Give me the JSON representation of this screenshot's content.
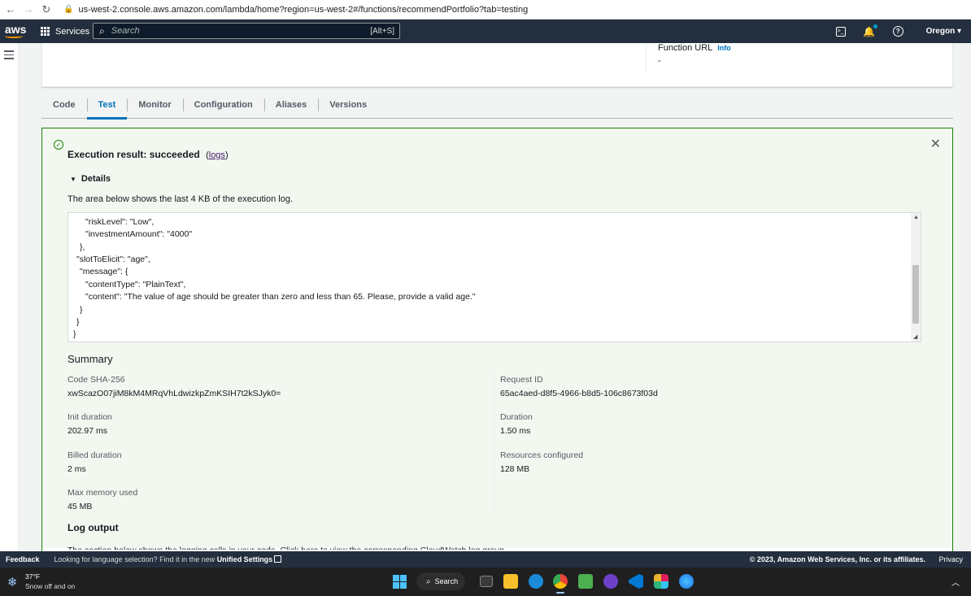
{
  "browser": {
    "url": "us-west-2.console.aws.amazon.com/lambda/home?region=us-west-2#/functions/recommendPortfolio?tab=testing",
    "back_icon": "arrow-left-icon",
    "forward_icon": "arrow-right-icon",
    "reload_icon": "reload-icon"
  },
  "aws_header": {
    "logo": "aws",
    "services_label": "Services",
    "search_placeholder": "Search",
    "search_shortcut": "[Alt+S]",
    "region": "Oregon ▾"
  },
  "overview": {
    "function_url_label": "Function URL",
    "function_url_info": "Info",
    "function_url_value": "-"
  },
  "tabs": [
    {
      "label": "Code"
    },
    {
      "label": "Test"
    },
    {
      "label": "Monitor"
    },
    {
      "label": "Configuration"
    },
    {
      "label": "Aliases"
    },
    {
      "label": "Versions"
    }
  ],
  "active_tab": "Test",
  "result": {
    "title": "Execution result: succeeded",
    "logs_open": "(",
    "logs_link": "logs",
    "logs_close": ")",
    "details_label": "Details",
    "description": "The area below shows the last 4 KB of the execution log.",
    "log_lines": [
      "\"riskLevel\": \"Low\",",
      "\"investmentAmount\": \"4000\"",
      "},",
      "\"slotToElicit\": \"age\",",
      "\"message\": {",
      "\"contentType\": \"PlainText\",",
      "\"content\": \"The value of age should be greater than zero and less than 65. Please, provide a valid age.\"",
      "}",
      "}",
      "}"
    ]
  },
  "summary": {
    "title": "Summary",
    "code_sha_label": "Code SHA-256",
    "code_sha_value": "xwScazO07jiM8kM4MRqVhLdwizkpZmKSIH7t2kSJyk0=",
    "request_id_label": "Request ID",
    "request_id_value": "65ac4aed-d8f5-4966-b8d5-106c8673f03d",
    "init_duration_label": "Init duration",
    "init_duration_value": "202.97 ms",
    "duration_label": "Duration",
    "duration_value": "1.50 ms",
    "billed_duration_label": "Billed duration",
    "billed_duration_value": "2 ms",
    "resources_label": "Resources configured",
    "resources_value": "128 MB",
    "max_memory_label": "Max memory used",
    "max_memory_value": "45 MB"
  },
  "log_output": {
    "title": "Log output",
    "text": "The section below shows the logging calls in your code. Click here to view the corresponding CloudWatch log group."
  },
  "footer": {
    "feedback": "Feedback",
    "lang_prefix": "Looking for language selection? Find it in the new",
    "lang_link": "Unified Settings",
    "copyright": "© 2023, Amazon Web Services, Inc. or its affiliates.",
    "privacy": "Privacy"
  },
  "taskbar": {
    "temperature": "37°F",
    "weather": "Snow off and on",
    "search_label": "Search"
  },
  "colors": {
    "aws_dark": "#232f3e",
    "aws_orange": "#ff9900",
    "link_blue": "#0073bb",
    "success_green": "#1d8102"
  }
}
